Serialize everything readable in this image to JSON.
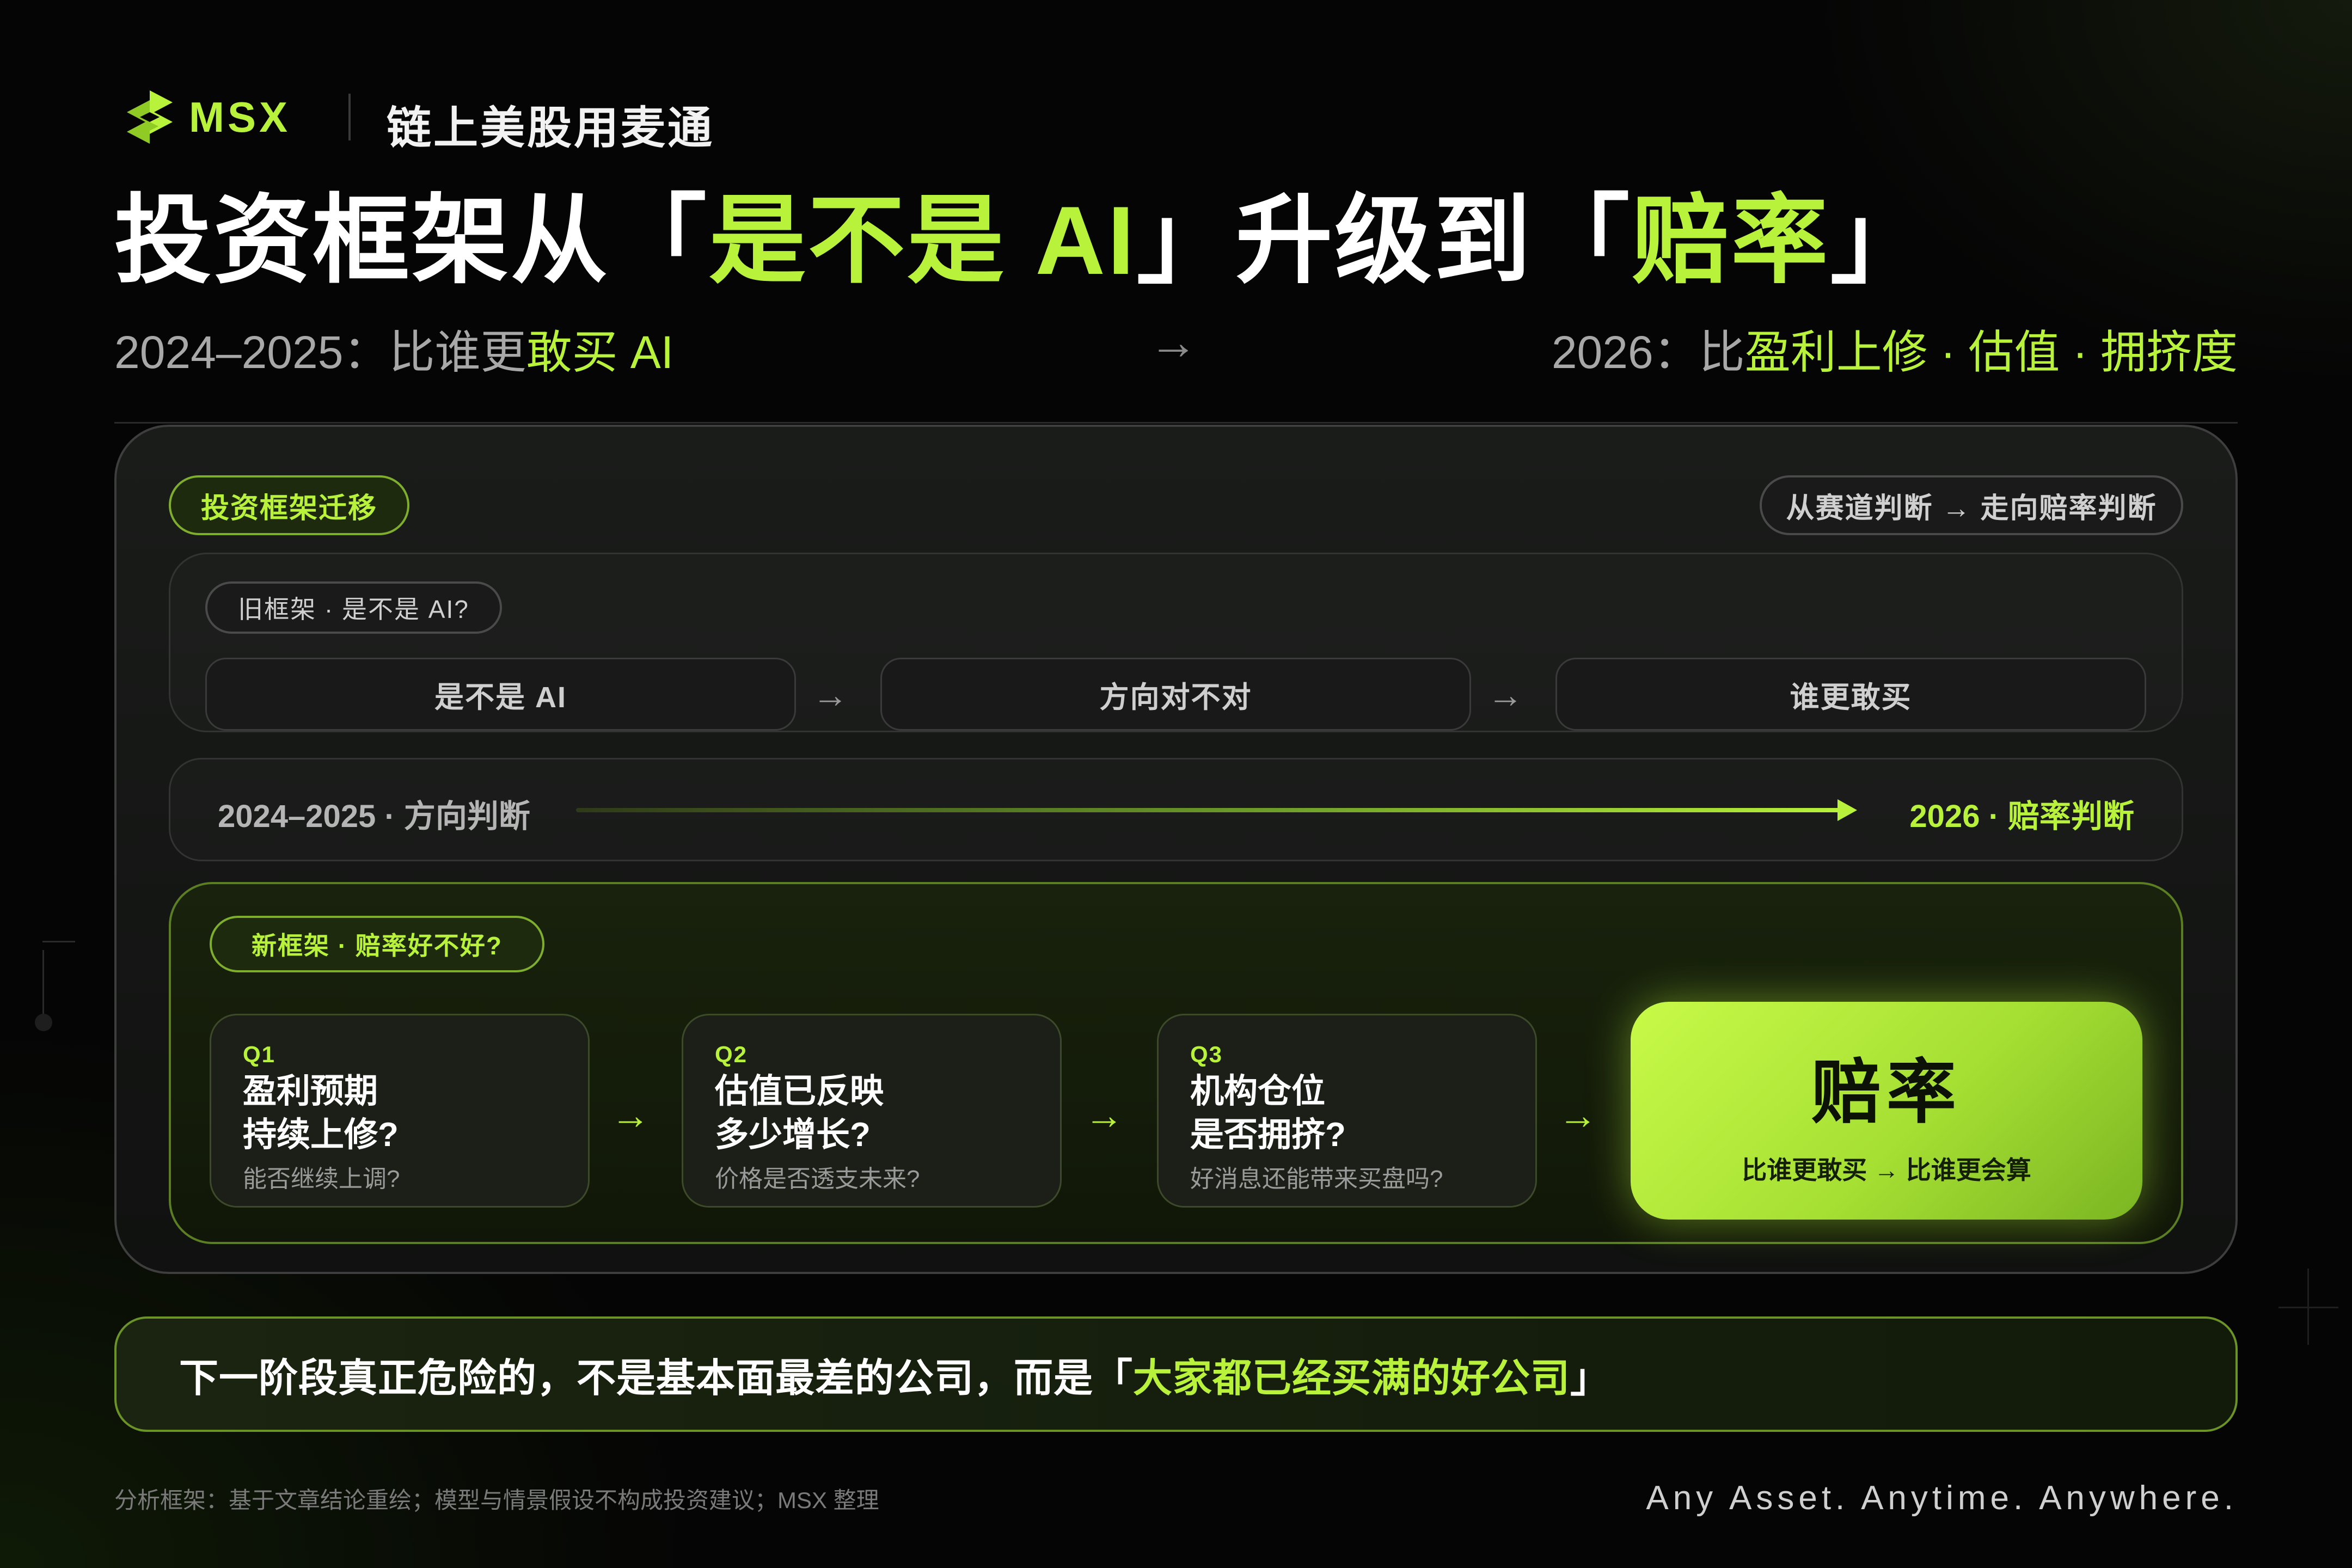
{
  "brand": {
    "name": "MSX",
    "logo_icon": "msx-s-logo-icon",
    "tagline": "链上美股用麦通"
  },
  "headline": {
    "part1": "投资框架从「",
    "part2": "是不是 AI",
    "part3": "」升级到「",
    "part4": "赔率",
    "part5": "」"
  },
  "subheadline": {
    "left_prefix": "2024–2025：比谁更",
    "left_highlight": "敢买 AI",
    "arrow": "→",
    "right_prefix": "2026：比",
    "right_highlight": "盈利上修 · 估值 · 拥挤度"
  },
  "card": {
    "label": "投资框架迁移",
    "right_label": "从赛道判断 → 走向赔率判断",
    "old_framework": {
      "label": "旧框架 · 是不是 AI?",
      "steps": [
        "是不是 AI",
        "方向对不对",
        "谁更敢买"
      ],
      "arrow": "→"
    },
    "timeline": {
      "left": "2024–2025 · 方向判断",
      "right": "2026 · 赔率判断"
    },
    "new_framework": {
      "label": "新框架 · 赔率好不好?",
      "questions": [
        {
          "tag": "Q1",
          "title_line1": "盈利预期",
          "title_line2": "持续上修?",
          "sub": "能否继续上调?"
        },
        {
          "tag": "Q2",
          "title_line1": "估值已反映",
          "title_line2": "多少增长?",
          "sub": "价格是否透支未来?"
        },
        {
          "tag": "Q3",
          "title_line1": "机构仓位",
          "title_line2": "是否拥挤?",
          "sub": "好消息还能带来买盘吗?"
        }
      ],
      "arrow": "→",
      "final": {
        "title": "赔率",
        "sub": "比谁更敢买 → 比谁更会算"
      }
    }
  },
  "quote": {
    "prefix": "下一阶段真正危险的，不是基本面最差的公司，而是「",
    "highlight": "大家都已经买满的好公司",
    "suffix": "」"
  },
  "footer": {
    "note": "分析框架：基于文章结论重绘；模型与情景假设不构成投资建议；MSX 整理",
    "slogan": "Any Asset. Anytime. Anywhere."
  },
  "colors": {
    "accent": "#b8f23a",
    "background": "#050505",
    "card": "#141514"
  }
}
